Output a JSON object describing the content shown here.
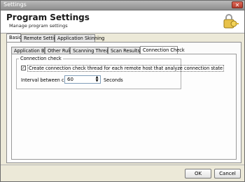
{
  "window": {
    "title": "Settings",
    "close_glyph": "✕"
  },
  "header": {
    "title": "Program Settings",
    "subtitle": "Manage program settings",
    "icon": "key-lock-icon"
  },
  "outer_tabs": [
    {
      "label": "Basic",
      "active": true
    },
    {
      "label": "Remote Settings",
      "active": false
    },
    {
      "label": "Application Skinning",
      "active": false
    }
  ],
  "inner_tabs": [
    {
      "label": "Application Basic",
      "active": false
    },
    {
      "label": "Other Rules",
      "active": false
    },
    {
      "label": "Scanning Threads",
      "active": false
    },
    {
      "label": "Scan Results",
      "active": false
    },
    {
      "label": "Connection Check",
      "active": true
    }
  ],
  "connection_group": {
    "legend": "Connection check",
    "checkbox_label": "Create connection check thread for each remote host that analyze connection state",
    "checkbox_checked": true,
    "checkbox_mark": "✓",
    "interval_label": "Interval between checks:",
    "interval_value": "60",
    "interval_unit": "Seconds",
    "spin_up": "▲",
    "spin_down": "▼"
  },
  "buttons": {
    "ok": "OK",
    "cancel": "Cancel"
  }
}
